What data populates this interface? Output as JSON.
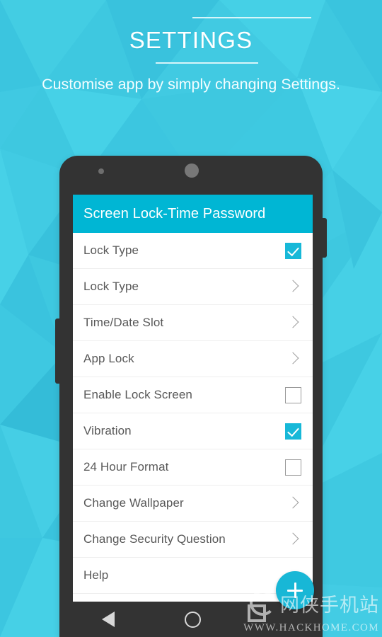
{
  "promo": {
    "title": "SETTINGS",
    "subtitle": "Customise app by simply changing Settings.",
    "rule_color": "#e4f8fb",
    "background_color": "#3ec8e0",
    "title_color": "#ffffff"
  },
  "phone": {
    "frame_color": "#333333",
    "sensor_icon": "sensor-dot-icon",
    "earpiece_icon": "earpiece-speaker-icon",
    "volume_button": "volume-rocker",
    "power_button": "power-button"
  },
  "app": {
    "bar": {
      "title": "Screen Lock-Time Password",
      "background_color": "#00b6d4",
      "title_color": "#ffffff"
    },
    "accent_color": "#18b7d6",
    "row_label_color": "#585858",
    "rows": [
      {
        "label": "Lock Type",
        "control": "checkbox",
        "checked": true
      },
      {
        "label": "Lock Type",
        "control": "chevron",
        "checked": false
      },
      {
        "label": "Time/Date Slot",
        "control": "chevron",
        "checked": false
      },
      {
        "label": "App Lock",
        "control": "chevron",
        "checked": false
      },
      {
        "label": "Enable Lock Screen",
        "control": "checkbox",
        "checked": false
      },
      {
        "label": "Vibration",
        "control": "checkbox",
        "checked": true
      },
      {
        "label": "24 Hour Format",
        "control": "checkbox",
        "checked": false
      },
      {
        "label": "Change Wallpaper",
        "control": "chevron",
        "checked": false
      },
      {
        "label": "Change Security Question",
        "control": "chevron",
        "checked": false
      },
      {
        "label": "Help",
        "control": "none",
        "checked": false
      }
    ],
    "fab": {
      "icon": "plus-icon",
      "color": "#18b7d6"
    }
  },
  "navbar": {
    "back": "back-triangle-icon",
    "home": "home-circle-icon",
    "recents": "recents-square-icon",
    "background_color": "#333333"
  },
  "watermark": {
    "logo": "hackhome-logo-icon",
    "site_name_cn": "网侠手机站",
    "site_url": "WWW.HACKHOME.COM"
  }
}
